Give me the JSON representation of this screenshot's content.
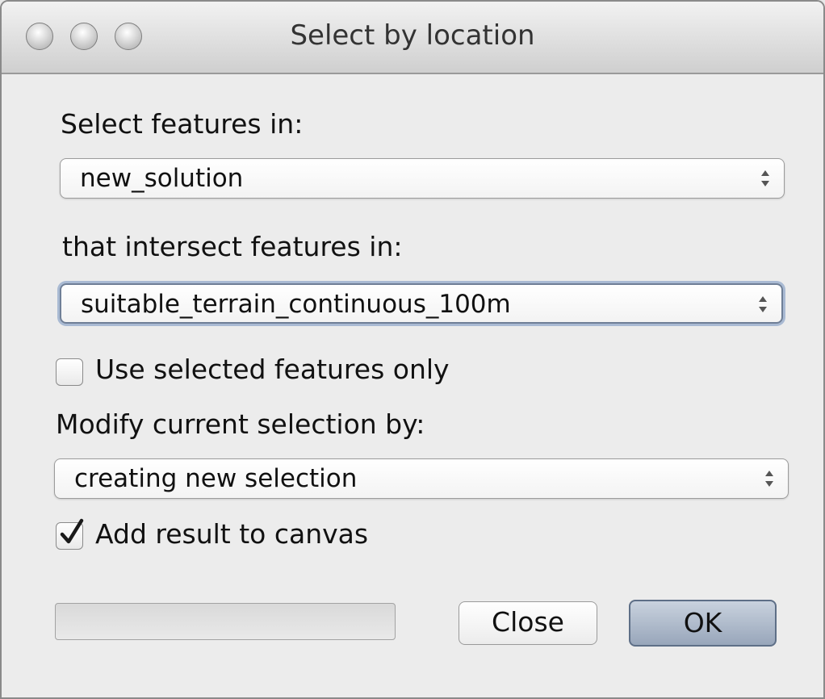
{
  "window": {
    "title": "Select by location"
  },
  "form": {
    "select_features_label": "Select features in:",
    "select_features_value": "new_solution",
    "intersect_label": "that intersect features in:",
    "intersect_value": "suitable_terrain_continuous_100m",
    "use_selected_label": "Use selected features only",
    "use_selected_checked": false,
    "modify_label": "Modify current selection by:",
    "modify_value": "creating new selection",
    "add_result_label": "Add result to canvas",
    "add_result_checked": true
  },
  "progress": {
    "value": 0
  },
  "buttons": {
    "close_label": "Close",
    "ok_label": "OK"
  },
  "icons": {
    "traffic_lights": [
      "close-window-icon",
      "minimize-window-icon",
      "zoom-window-icon"
    ],
    "combo_arrows": "up-down-arrows-icon",
    "checkmark": "checkmark-icon"
  },
  "colors": {
    "default_button": "#98a6ba",
    "focus_ring": "#a9bad3"
  }
}
